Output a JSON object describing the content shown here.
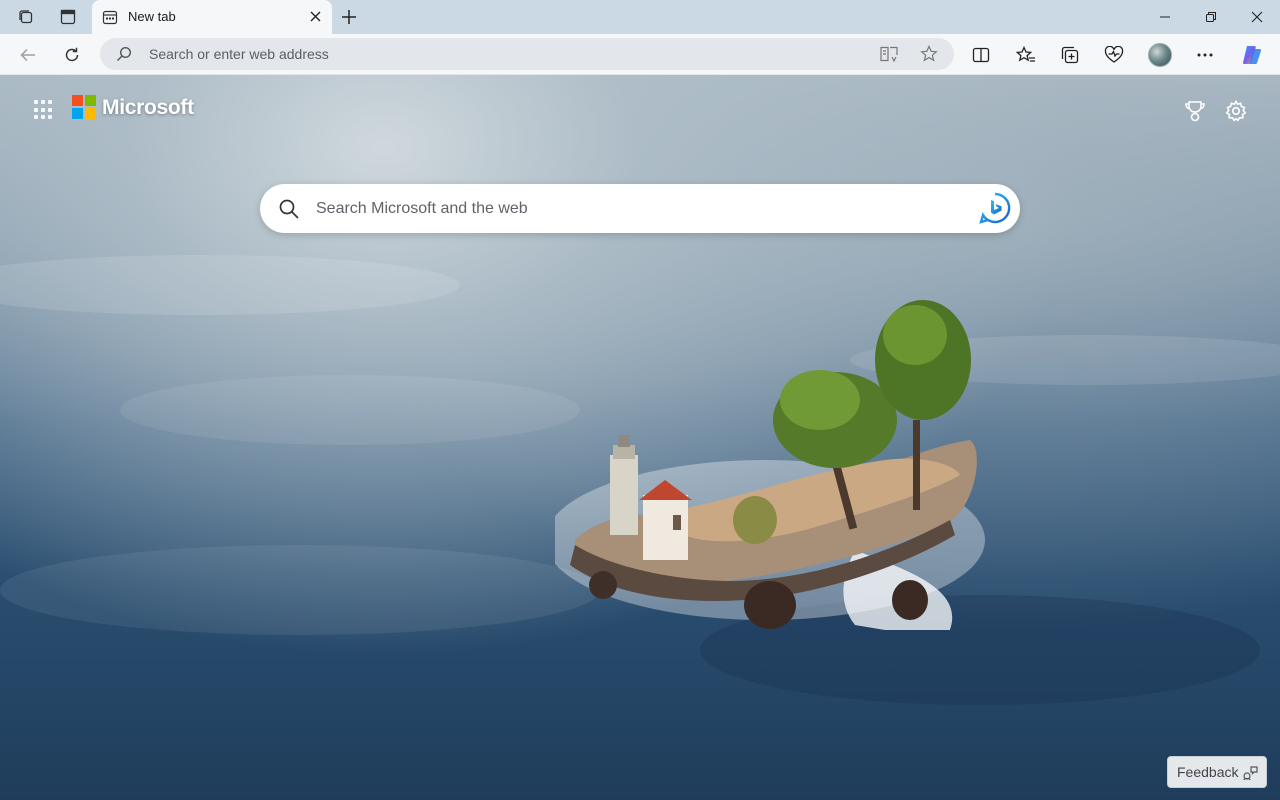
{
  "tab": {
    "title": "New tab"
  },
  "omnibox": {
    "placeholder": "Search or enter web address"
  },
  "ntp": {
    "brand": "Microsoft",
    "search_placeholder": "Search Microsoft and the web",
    "feedback_label": "Feedback"
  },
  "icons": {
    "titlebar": [
      "workspaces-icon",
      "vertical-tabs-icon",
      "new-tab-favicon",
      "close-tab-icon",
      "new-tab-plus-icon",
      "minimize-icon",
      "restore-icon",
      "close-window-icon"
    ],
    "toolbar": [
      "back-icon",
      "refresh-icon",
      "search-icon",
      "immersive-reader-icon",
      "favorite-star-icon",
      "split-screen-icon",
      "favorites-icon",
      "collections-icon",
      "browser-essentials-icon",
      "profile-avatar",
      "more-icon",
      "copilot-icon"
    ],
    "ntp": [
      "app-launcher-icon",
      "microsoft-logo",
      "rewards-trophy-icon",
      "settings-gear-icon",
      "bing-icon",
      "feedback-icon"
    ]
  },
  "colors": {
    "tabstrip_bg": "#cbd9e4",
    "toolbar_bg": "#f5f7f9",
    "omnibox_bg": "#e3e6ea",
    "ms_red": "#f25022",
    "ms_green": "#7fba00",
    "ms_blue": "#00a4ef",
    "ms_yellow": "#ffb900"
  }
}
